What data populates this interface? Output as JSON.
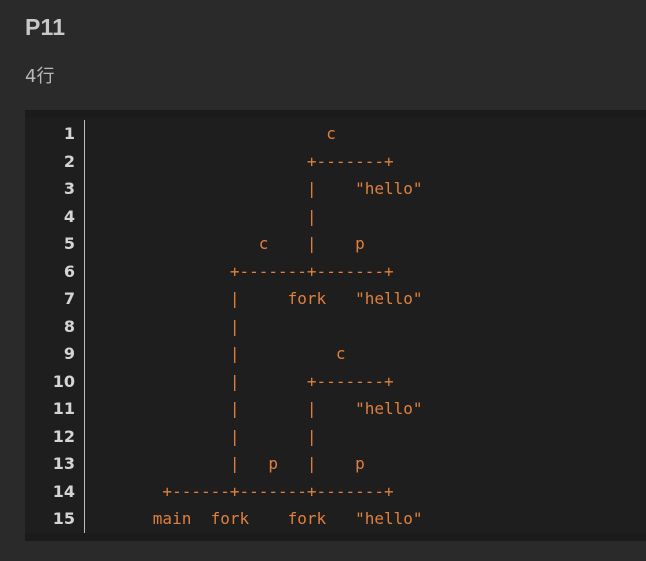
{
  "header": {
    "title": "P11",
    "subtitle": "4行"
  },
  "code_block": {
    "line_numbers": [
      "1",
      "2",
      "3",
      "4",
      "5",
      "6",
      "7",
      "8",
      "9",
      "10",
      "11",
      "12",
      "13",
      "14",
      "15"
    ],
    "lines": [
      "                        c",
      "                      +-------+",
      "                      |    \"hello\"",
      "                      |",
      "                 c    |    p",
      "              +-------+-------+",
      "              |     fork   \"hello\"",
      "              |",
      "              |          c",
      "              |       +-------+",
      "              |       |    \"hello\"",
      "              |       |",
      "              |   p   |    p",
      "       +------+-------+-------+",
      "      main  fork    fork   \"hello\""
    ],
    "text_color": "#e0803c",
    "line_number_color": "#d4d4d4"
  }
}
